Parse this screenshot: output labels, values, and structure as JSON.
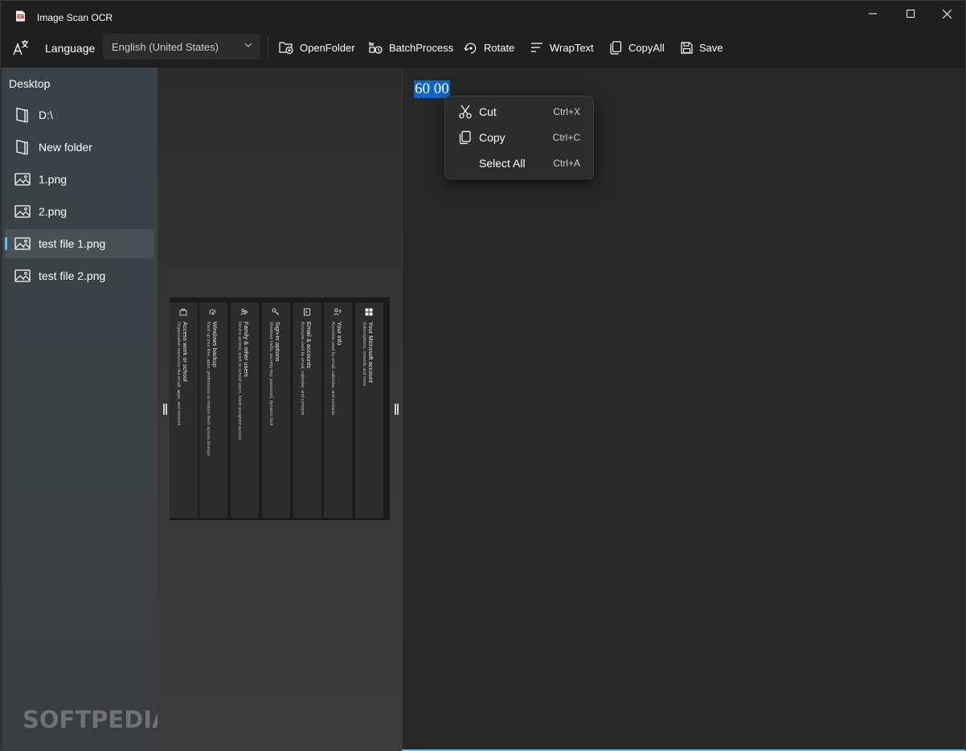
{
  "window": {
    "title": "Image Scan OCR",
    "accent_color": "#4cc2ff",
    "selection_color": "#0a65c7"
  },
  "toolbar": {
    "language_label": "Language",
    "language_value": "English (United States)",
    "buttons": [
      {
        "label": "OpenFolder",
        "icon": "folder-add-icon"
      },
      {
        "label": "BatchProcess",
        "icon": "batch-process-icon"
      },
      {
        "label": "Rotate",
        "icon": "rotate-icon"
      },
      {
        "label": "WrapText",
        "icon": "wrap-text-icon"
      },
      {
        "label": "CopyAll",
        "icon": "copy-icon"
      },
      {
        "label": "Save",
        "icon": "save-icon"
      }
    ]
  },
  "sidebar": {
    "header": "Desktop",
    "items": [
      {
        "label": "D:\\",
        "icon": "folder-icon",
        "selected": false
      },
      {
        "label": "New folder",
        "icon": "folder-icon",
        "selected": false
      },
      {
        "label": "1.png",
        "icon": "image-icon",
        "selected": false
      },
      {
        "label": "2.png",
        "icon": "image-icon",
        "selected": false
      },
      {
        "label": "test file 1.png",
        "icon": "image-icon",
        "selected": true
      },
      {
        "label": "test file 2.png",
        "icon": "image-icon",
        "selected": false
      }
    ]
  },
  "preview": {
    "cards": [
      {
        "title": "Access work or school",
        "subtitle": "Organization resources like email, apps, and network",
        "icon": "briefcase-icon"
      },
      {
        "title": "Windows backup",
        "subtitle": "Back up your files, apps, preferences to restore them across devices",
        "icon": "backup-icon"
      },
      {
        "title": "Family & other users",
        "subtitle": "Device access, work or school users, kiosk assigned access",
        "icon": "family-icon"
      },
      {
        "title": "Sign-in options",
        "subtitle": "Windows Hello, security key, password, dynamic lock",
        "icon": "key-icon"
      },
      {
        "title": "Email & accounts",
        "subtitle": "Accounts used by email, calendar, and contacts",
        "icon": "email-icon"
      },
      {
        "title": "Your info",
        "subtitle": "Accounts used by email, calendar, and contacts",
        "icon": "person-icon"
      },
      {
        "title": "Your Microsoft account",
        "subtitle": "Subscriptions, rewards and more",
        "icon": "windows-logo-icon"
      }
    ],
    "watermark": "SOFTPEDIA",
    "watermark_mark": "®"
  },
  "ocr": {
    "text": "60 00"
  },
  "context_menu": {
    "items": [
      {
        "label": "Cut",
        "shortcut": "Ctrl+X",
        "icon": "scissors-icon"
      },
      {
        "label": "Copy",
        "shortcut": "Ctrl+C",
        "icon": "copy-icon"
      },
      {
        "label": "Select All",
        "shortcut": "Ctrl+A",
        "icon": ""
      }
    ]
  }
}
